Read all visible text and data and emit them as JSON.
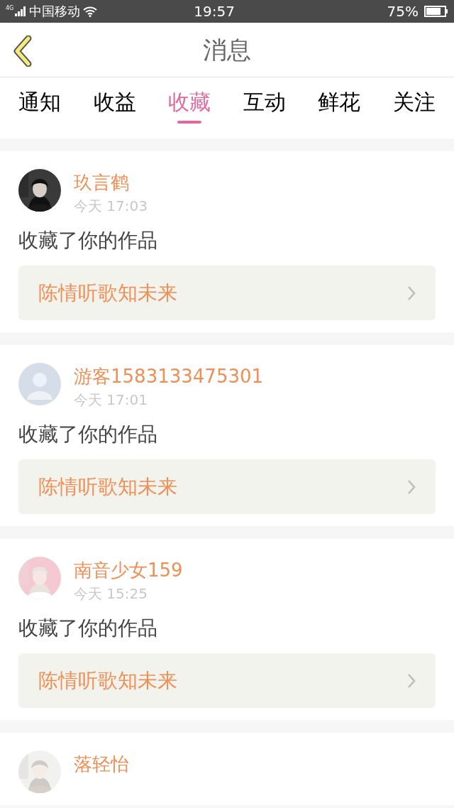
{
  "status_bar": {
    "network": "4G",
    "carrier": "中国移动",
    "time": "19:57",
    "battery": "75%"
  },
  "header": {
    "title": "消息"
  },
  "tabs": [
    {
      "label": "通知",
      "selected": false
    },
    {
      "label": "收益",
      "selected": false
    },
    {
      "label": "收藏",
      "selected": true
    },
    {
      "label": "互动",
      "selected": false
    },
    {
      "label": "鲜花",
      "selected": false
    },
    {
      "label": "关注",
      "selected": false
    }
  ],
  "messages": [
    {
      "name": "玖言鹤",
      "time": "今天 17:03",
      "text": "收藏了你的作品",
      "work": "陈情听歌知未来"
    },
    {
      "avatar": {
        "kind": "default"
      },
      "name": "游客1583133475301",
      "time": "今天 17:01",
      "text": "收藏了你的作品",
      "work": "陈情听歌知未来"
    },
    {
      "name": "南音少女159",
      "time": "今天 15:25",
      "text": "收藏了你的作品",
      "work": "陈情听歌知未来"
    },
    {
      "name": "落轻怡"
    }
  ]
}
